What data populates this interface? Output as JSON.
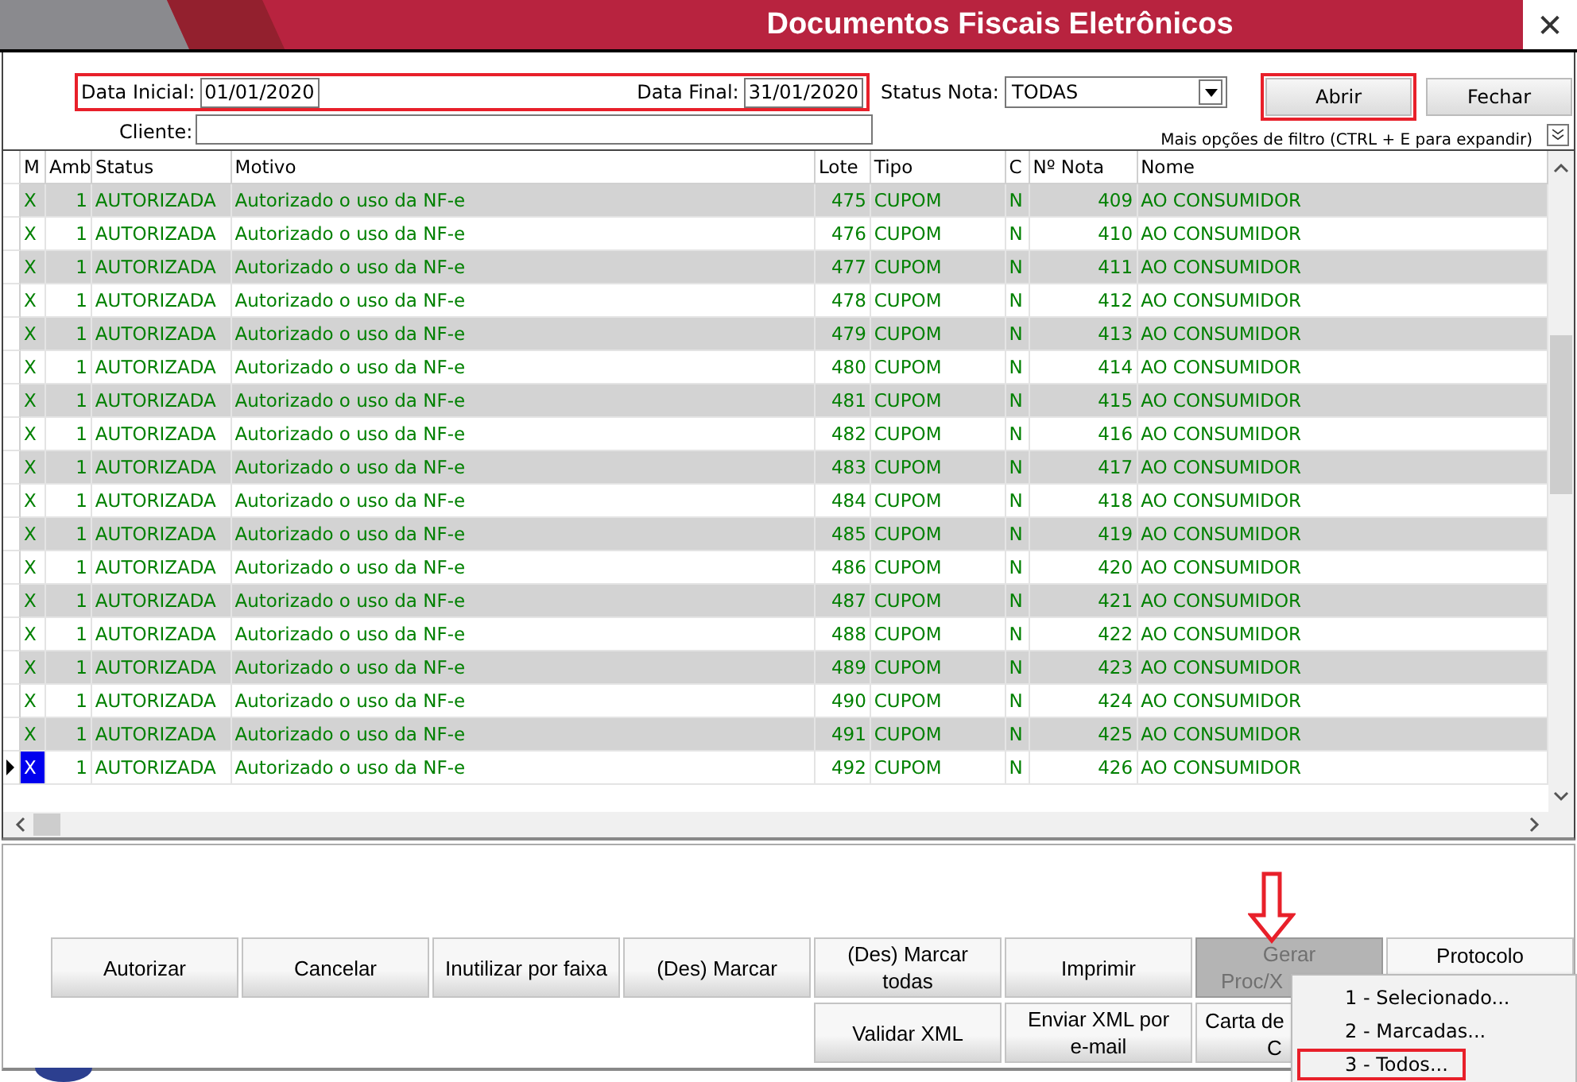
{
  "window": {
    "title": "Documentos Fiscais Eletrônicos",
    "close": "✕"
  },
  "filter": {
    "date_group_highlighted": true,
    "fields": [
      {
        "label": "Data Inicial:",
        "value": "01/01/2020"
      },
      {
        "label": "Data Final:",
        "value": "31/01/2020"
      }
    ],
    "status": {
      "label": "Status Nota:",
      "value": "TODAS"
    },
    "client": {
      "label": "Cliente:"
    },
    "buttons": [
      {
        "label": "Abrir",
        "highlighted": true
      },
      {
        "label": "Fechar",
        "highlighted": false
      }
    ],
    "more_hint": "Mais opções de filtro (CTRL + E para expandir)"
  },
  "table": {
    "columns": [
      "M",
      "Amb",
      "Status",
      "Motivo",
      "Lote",
      "Tipo",
      "C",
      "Nº Nota",
      "Nome"
    ],
    "rows": [
      {
        "selected": false,
        "cells": [
          "X",
          "1",
          "AUTORIZADA",
          "Autorizado o uso da NF-e",
          "475",
          "CUPOM",
          "N",
          "409",
          "AO CONSUMIDOR"
        ]
      },
      {
        "selected": false,
        "cells": [
          "X",
          "1",
          "AUTORIZADA",
          "Autorizado o uso da NF-e",
          "476",
          "CUPOM",
          "N",
          "410",
          "AO CONSUMIDOR"
        ]
      },
      {
        "selected": false,
        "cells": [
          "X",
          "1",
          "AUTORIZADA",
          "Autorizado o uso da NF-e",
          "477",
          "CUPOM",
          "N",
          "411",
          "AO CONSUMIDOR"
        ]
      },
      {
        "selected": false,
        "cells": [
          "X",
          "1",
          "AUTORIZADA",
          "Autorizado o uso da NF-e",
          "478",
          "CUPOM",
          "N",
          "412",
          "AO CONSUMIDOR"
        ]
      },
      {
        "selected": false,
        "cells": [
          "X",
          "1",
          "AUTORIZADA",
          "Autorizado o uso da NF-e",
          "479",
          "CUPOM",
          "N",
          "413",
          "AO CONSUMIDOR"
        ]
      },
      {
        "selected": false,
        "cells": [
          "X",
          "1",
          "AUTORIZADA",
          "Autorizado o uso da NF-e",
          "480",
          "CUPOM",
          "N",
          "414",
          "AO CONSUMIDOR"
        ]
      },
      {
        "selected": false,
        "cells": [
          "X",
          "1",
          "AUTORIZADA",
          "Autorizado o uso da NF-e",
          "481",
          "CUPOM",
          "N",
          "415",
          "AO CONSUMIDOR"
        ]
      },
      {
        "selected": false,
        "cells": [
          "X",
          "1",
          "AUTORIZADA",
          "Autorizado o uso da NF-e",
          "482",
          "CUPOM",
          "N",
          "416",
          "AO CONSUMIDOR"
        ]
      },
      {
        "selected": false,
        "cells": [
          "X",
          "1",
          "AUTORIZADA",
          "Autorizado o uso da NF-e",
          "483",
          "CUPOM",
          "N",
          "417",
          "AO CONSUMIDOR"
        ]
      },
      {
        "selected": false,
        "cells": [
          "X",
          "1",
          "AUTORIZADA",
          "Autorizado o uso da NF-e",
          "484",
          "CUPOM",
          "N",
          "418",
          "AO CONSUMIDOR"
        ]
      },
      {
        "selected": false,
        "cells": [
          "X",
          "1",
          "AUTORIZADA",
          "Autorizado o uso da NF-e",
          "485",
          "CUPOM",
          "N",
          "419",
          "AO CONSUMIDOR"
        ]
      },
      {
        "selected": false,
        "cells": [
          "X",
          "1",
          "AUTORIZADA",
          "Autorizado o uso da NF-e",
          "486",
          "CUPOM",
          "N",
          "420",
          "AO CONSUMIDOR"
        ]
      },
      {
        "selected": false,
        "cells": [
          "X",
          "1",
          "AUTORIZADA",
          "Autorizado o uso da NF-e",
          "487",
          "CUPOM",
          "N",
          "421",
          "AO CONSUMIDOR"
        ]
      },
      {
        "selected": false,
        "cells": [
          "X",
          "1",
          "AUTORIZADA",
          "Autorizado o uso da NF-e",
          "488",
          "CUPOM",
          "N",
          "422",
          "AO CONSUMIDOR"
        ]
      },
      {
        "selected": false,
        "cells": [
          "X",
          "1",
          "AUTORIZADA",
          "Autorizado o uso da NF-e",
          "489",
          "CUPOM",
          "N",
          "423",
          "AO CONSUMIDOR"
        ]
      },
      {
        "selected": false,
        "cells": [
          "X",
          "1",
          "AUTORIZADA",
          "Autorizado o uso da NF-e",
          "490",
          "CUPOM",
          "N",
          "424",
          "AO CONSUMIDOR"
        ]
      },
      {
        "selected": false,
        "cells": [
          "X",
          "1",
          "AUTORIZADA",
          "Autorizado o uso da NF-e",
          "491",
          "CUPOM",
          "N",
          "425",
          "AO CONSUMIDOR"
        ]
      },
      {
        "selected": true,
        "cells": [
          "X",
          "1",
          "AUTORIZADA",
          "Autorizado o uso da NF-e",
          "492",
          "CUPOM",
          "N",
          "426",
          "AO CONSUMIDOR"
        ]
      }
    ]
  },
  "actions": {
    "row_1": [
      {
        "lines": [
          "Autorizar"
        ],
        "disabled": false
      },
      {
        "lines": [
          "Cancelar"
        ],
        "disabled": false
      },
      {
        "lines": [
          "Inutilizar por faixa"
        ],
        "disabled": false
      },
      {
        "lines": [
          "(Des) Marcar"
        ],
        "disabled": false
      },
      {
        "lines": [
          "(Des) Marcar",
          "todas"
        ],
        "disabled": false
      },
      {
        "lines": [
          "Imprimir"
        ],
        "disabled": false
      },
      {
        "lines": [
          "Gerar",
          "Proc/X"
        ],
        "disabled": true
      },
      {
        "lines": [
          "Protocolo"
        ],
        "disabled": false
      }
    ],
    "row_2": [
      {
        "lines": [
          "Validar XML"
        ],
        "disabled": false
      },
      {
        "lines": [
          "Enviar XML por",
          "e-mail"
        ],
        "disabled": false
      },
      {
        "lines": [
          "Carta de",
          "C"
        ],
        "disabled": false
      }
    ]
  },
  "menu": {
    "items": [
      {
        "label": "1 - Selecionado...",
        "highlighted": false
      },
      {
        "label": "2 - Marcadas...",
        "highlighted": false
      },
      {
        "label": "3 - Todos...",
        "highlighted": true
      }
    ]
  }
}
